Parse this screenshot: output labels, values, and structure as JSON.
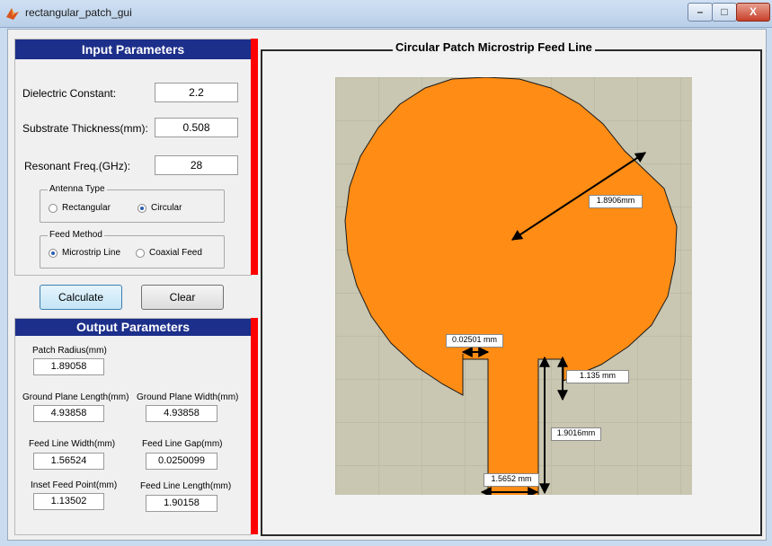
{
  "window": {
    "title": "rectangular_patch_gui",
    "minimize_label": "–",
    "maximize_label": "□",
    "close_label": "X"
  },
  "input": {
    "header": "Input Parameters",
    "dielectric_label": "Dielectric Constant:",
    "dielectric_value": "2.2",
    "thickness_label": "Substrate Thickness(mm):",
    "thickness_value": "0.508",
    "freq_label": "Resonant Freq.(GHz):",
    "freq_value": "28",
    "antenna_type": {
      "title": "Antenna Type",
      "rectangular": "Rectangular",
      "circular": "Circular",
      "selected": "Circular"
    },
    "feed_method": {
      "title": "Feed Method",
      "microstrip": "Microstrip Line",
      "coaxial": "Coaxial Feed",
      "selected": "Microstrip Line"
    }
  },
  "actions": {
    "calculate": "Calculate",
    "clear": "Clear"
  },
  "output": {
    "header": "Output Parameters",
    "patch_radius_label": "Patch Radius(mm)",
    "patch_radius_value": "1.89058",
    "gp_length_label": "Ground Plane Length(mm)",
    "gp_length_value": "4.93858",
    "gp_width_label": "Ground Plane Width(mm)",
    "gp_width_value": "4.93858",
    "feed_width_label": "Feed Line Width(mm)",
    "feed_width_value": "1.56524",
    "feed_gap_label": "Feed Line Gap(mm)",
    "feed_gap_value": "0.0250099",
    "inset_label": "Inset Feed Point(mm)",
    "inset_value": "1.13502",
    "feed_length_label": "Feed Line Length(mm)",
    "feed_length_value": "1.90158"
  },
  "plot": {
    "title": "Circular Patch Microstrip Feed Line",
    "radius_annotation": "1.8906mm",
    "gap_annotation": "0.02501 mm",
    "inset_annotation": "1.135 mm",
    "feed_length_annotation": "1.9016mm",
    "feed_width_annotation": "1.5652 mm",
    "colors": {
      "patch": "#ff8c14",
      "substrate": "#c9c6b1",
      "grid": "#b3b09c",
      "header": "#1c2f8a",
      "accent_bar": "#ff0000"
    }
  }
}
